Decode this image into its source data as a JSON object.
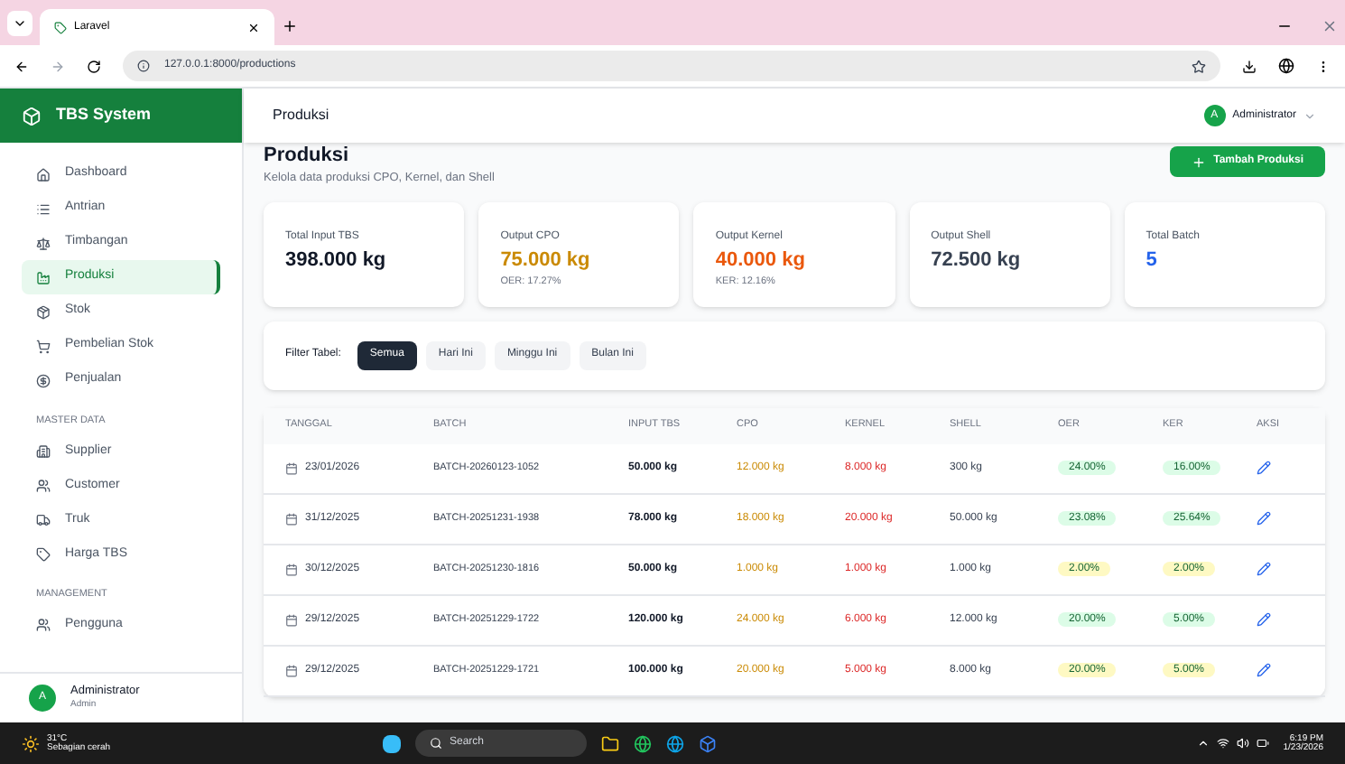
{
  "browser": {
    "tab_title": "Laravel",
    "url": "127.0.0.1:8000/productions"
  },
  "sidebar": {
    "brand": "TBS System",
    "items": [
      {
        "label": "Dashboard",
        "kind": "home",
        "selected": false
      },
      {
        "label": "Antrian",
        "kind": "list",
        "selected": false
      },
      {
        "label": "Timbangan",
        "kind": "scale",
        "selected": false
      },
      {
        "label": "Produksi",
        "kind": "factory",
        "selected": true
      },
      {
        "label": "Stok",
        "kind": "box",
        "selected": false
      },
      {
        "label": "Pembelian Stok",
        "kind": "cart",
        "selected": false
      },
      {
        "label": "Penjualan",
        "kind": "dollar",
        "selected": false
      }
    ],
    "sections": [
      {
        "title": "MASTER DATA",
        "items": [
          {
            "label": "Supplier",
            "kind": "building",
            "selected": false
          },
          {
            "label": "Customer",
            "kind": "users",
            "selected": false
          },
          {
            "label": "Truk",
            "kind": "truck",
            "selected": false
          },
          {
            "label": "Harga TBS",
            "kind": "tag",
            "selected": false
          }
        ]
      },
      {
        "title": "MANAGEMENT",
        "items": [
          {
            "label": "Pengguna",
            "kind": "users",
            "selected": false
          }
        ]
      }
    ],
    "user": {
      "avatar": "A",
      "name": "Administrator",
      "role": "Admin"
    }
  },
  "header": {
    "title": "Produksi",
    "avatar": "A",
    "user": "Administrator"
  },
  "page": {
    "title": "Produksi",
    "subtitle": "Kelola data produksi CPO, Kernel, dan Shell",
    "add_button": "Tambah Produksi"
  },
  "stats": [
    {
      "label": "Total Input TBS",
      "value": "398.000 kg",
      "color": "#111827"
    },
    {
      "label": "Output CPO",
      "value": "75.000 kg",
      "color": "#ca8a04",
      "note": "OER: 17.27%"
    },
    {
      "label": "Output Kernel",
      "value": "40.000 kg",
      "color": "#ea580c",
      "note": "KER: 12.16%"
    },
    {
      "label": "Output Shell",
      "value": "72.500 kg",
      "color": "#374151"
    },
    {
      "label": "Total Batch",
      "value": "5",
      "color": "#2563eb"
    }
  ],
  "filter": {
    "label": "Filter Tabel:",
    "options": [
      {
        "label": "Semua",
        "selected": true
      },
      {
        "label": "Hari Ini",
        "selected": false
      },
      {
        "label": "Minggu Ini",
        "selected": false
      },
      {
        "label": "Bulan Ini",
        "selected": false
      }
    ]
  },
  "table": {
    "columns": [
      "TANGGAL",
      "BATCH",
      "INPUT TBS",
      "CPO",
      "KERNEL",
      "SHELL",
      "OER",
      "KER",
      "AKSI"
    ],
    "rows": [
      {
        "date": "23/01/2026",
        "batch": "BATCH-20260123-1052",
        "input": "50.000 kg",
        "cpo": "12.000 kg",
        "kernel": "8.000 kg",
        "shell": "300 kg",
        "oer": {
          "text": "24.00%",
          "color": "#dcfce7"
        },
        "ker": {
          "text": "16.00%",
          "color": "#dcfce7"
        }
      },
      {
        "date": "31/12/2025",
        "batch": "BATCH-20251231-1938",
        "input": "78.000 kg",
        "cpo": "18.000 kg",
        "kernel": "20.000 kg",
        "shell": "50.000 kg",
        "oer": {
          "text": "23.08%",
          "color": "#dcfce7"
        },
        "ker": {
          "text": "25.64%",
          "color": "#dcfce7"
        }
      },
      {
        "date": "30/12/2025",
        "batch": "BATCH-20251230-1816",
        "input": "50.000 kg",
        "cpo": "1.000 kg",
        "kernel": "1.000 kg",
        "shell": "1.000 kg",
        "oer": {
          "text": "2.00%",
          "color": "#fef9c3"
        },
        "ker": {
          "text": "2.00%",
          "color": "#fef9c3"
        }
      },
      {
        "date": "29/12/2025",
        "batch": "BATCH-20251229-1722",
        "input": "120.000 kg",
        "cpo": "24.000 kg",
        "kernel": "6.000 kg",
        "shell": "12.000 kg",
        "oer": {
          "text": "20.00%",
          "color": "#dcfce7"
        },
        "ker": {
          "text": "5.00%",
          "color": "#dcfce7"
        }
      },
      {
        "date": "29/12/2025",
        "batch": "BATCH-20251229-1721",
        "input": "100.000 kg",
        "cpo": "20.000 kg",
        "kernel": "5.000 kg",
        "shell": "8.000 kg",
        "oer": {
          "text": "20.00%",
          "color": "#fef9c3"
        },
        "ker": {
          "text": "5.00%",
          "color": "#fef9c3"
        }
      }
    ]
  },
  "taskbar": {
    "weather_temp": "31°C",
    "weather_text": "Sebagian cerah",
    "search": "Search",
    "time": "6:19 PM",
    "date": "1/23/2026"
  }
}
